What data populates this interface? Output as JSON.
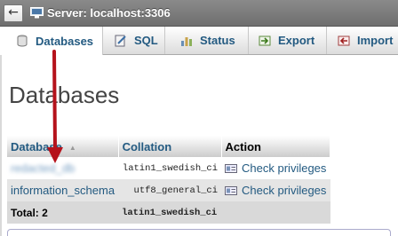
{
  "topbar": {
    "back_glyph": "←",
    "server_label": "Server: localhost:3306",
    "icon": "server-icon"
  },
  "tabs": [
    {
      "label": "Databases",
      "icon": "database-icon",
      "active": true
    },
    {
      "label": "SQL",
      "icon": "sql-icon",
      "active": false
    },
    {
      "label": "Status",
      "icon": "status-chart-icon",
      "active": false
    },
    {
      "label": "Export",
      "icon": "export-icon",
      "active": false
    },
    {
      "label": "Import",
      "icon": "import-icon",
      "active": false
    }
  ],
  "page": {
    "title": "Databases"
  },
  "table": {
    "headers": {
      "database": "Database",
      "collation": "Collation",
      "action": "Action"
    },
    "rows": [
      {
        "database": "redacted_db",
        "collation": "latin1_swedish_ci",
        "action": "Check privileges",
        "blurred": true
      },
      {
        "database": "information_schema",
        "collation": "utf8_general_ci",
        "action": "Check privileges",
        "blurred": false
      }
    ],
    "total": {
      "label": "Total: 2",
      "collation": "latin1_swedish_ci"
    }
  },
  "colors": {
    "link": "#235a81",
    "arrow": "#b5121b",
    "topbar": "#7a7a7a"
  }
}
